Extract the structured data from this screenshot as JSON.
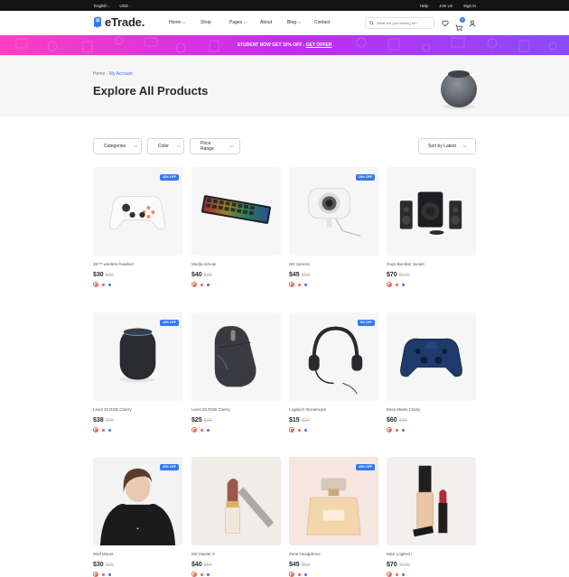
{
  "topbar": {
    "language": "English",
    "currency": "USD",
    "links": [
      "Help",
      "Join Us",
      "Sign In"
    ]
  },
  "brand": {
    "name": "eTrade.",
    "accent": "#3577f0"
  },
  "nav": {
    "items": [
      "Home",
      "Shop",
      "Pages",
      "About",
      "Blog",
      "Contact"
    ],
    "active": "Shop"
  },
  "search": {
    "placeholder": "What are you looking for?"
  },
  "cart": {
    "count": "0"
  },
  "promo": {
    "text": "STUDENT NOW GET 10% OFF :",
    "link": "GET OFFER",
    "gradient": [
      "#ff3ec2",
      "#c32cf0",
      "#8a4bfb"
    ]
  },
  "hero": {
    "breadcrumb_home": "Home",
    "breadcrumb_current": "My Account",
    "title": "Explore All Products"
  },
  "filters": {
    "categories": "Categories",
    "color": "Color",
    "price": "Price Range",
    "sort": "Sort by Latest"
  },
  "products": [
    {
      "name": "3D™ wireless headset",
      "price": "$30",
      "old": "$30",
      "discount": "20% OFF",
      "icon": "game-controller-icon"
    },
    {
      "name": "Media remote",
      "price": "$40",
      "old": "$30",
      "discount": "",
      "icon": "keyboard-icon"
    },
    {
      "name": "HD camera",
      "price": "$45",
      "old": "$60",
      "discount": "20% OFF",
      "icon": "webcam-icon"
    },
    {
      "name": "Guys Bomber Jacket",
      "price": "$70",
      "old": "$100",
      "discount": "",
      "icon": "speakers-icon"
    },
    {
      "name": "Level 20 RGB Cherry",
      "price": "$38",
      "old": "$50",
      "discount": "15% OFF",
      "icon": "smart-speaker-icon"
    },
    {
      "name": "Level 20 RGB Cherry",
      "price": "$25",
      "old": "$40",
      "discount": "",
      "icon": "mouse-icon"
    },
    {
      "name": "Logitech Streamcam",
      "price": "$15",
      "old": "$20",
      "discount": "5% OFF",
      "icon": "headset-icon"
    },
    {
      "name": "Bass Meets Clarity",
      "price": "$60",
      "old": "$80",
      "discount": "",
      "icon": "gamepad-icon"
    },
    {
      "name": "Wall Mount",
      "price": "$30",
      "old": "$30",
      "discount": "20% OFF",
      "icon": "hoodie-model-icon"
    },
    {
      "name": "MX Master 3",
      "price": "$40",
      "old": "$50",
      "discount": "",
      "icon": "lipstick-icon"
    },
    {
      "name": "Zone Headphone",
      "price": "$45",
      "old": "$60",
      "discount": "20% OFF",
      "icon": "perfume-icon"
    },
    {
      "name": "Mice Logitech",
      "price": "$70",
      "old": "$100",
      "discount": "",
      "icon": "cosmetics-icon"
    }
  ],
  "swatches": [
    "#e76458",
    "#e76458",
    "#3577f0"
  ]
}
